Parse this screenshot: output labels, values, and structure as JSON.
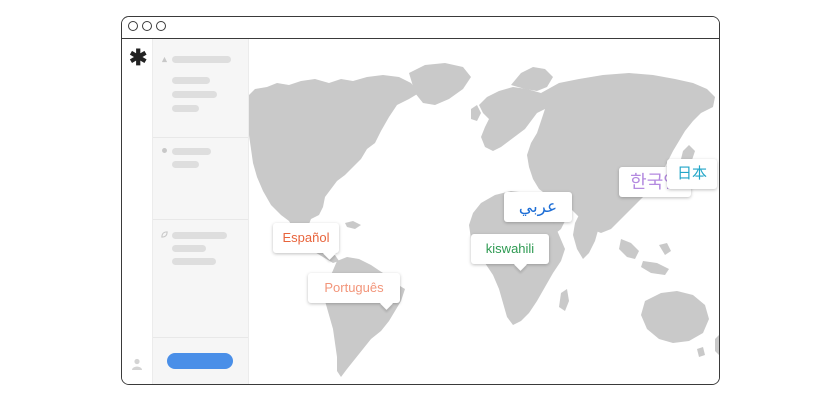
{
  "app": {
    "window_controls": [
      "close",
      "minimize",
      "maximize"
    ],
    "logo_glyph": "✱",
    "sidebar": {
      "sections": [
        {
          "icon": "triangle-icon"
        },
        {
          "icon": "dot-icon"
        },
        {
          "icon": "leaf-icon"
        }
      ],
      "footer_icon": "person-icon"
    },
    "primary_button_color": "#4a8fe8"
  },
  "map": {
    "land_color": "#c9c9c9",
    "language_tags": [
      {
        "id": "spanish",
        "text": "Español",
        "color": "#e8643c"
      },
      {
        "id": "portuguese",
        "text": "Português",
        "color": "#f2957a"
      },
      {
        "id": "arabic",
        "text": "عربي",
        "color": "#1f6fd6"
      },
      {
        "id": "swahili",
        "text": "kiswahili",
        "color": "#2e9a52"
      },
      {
        "id": "korean",
        "text": "한국인",
        "color": "#b48ae0"
      },
      {
        "id": "japanese",
        "text": "日本",
        "color": "#22a6c8"
      }
    ]
  }
}
